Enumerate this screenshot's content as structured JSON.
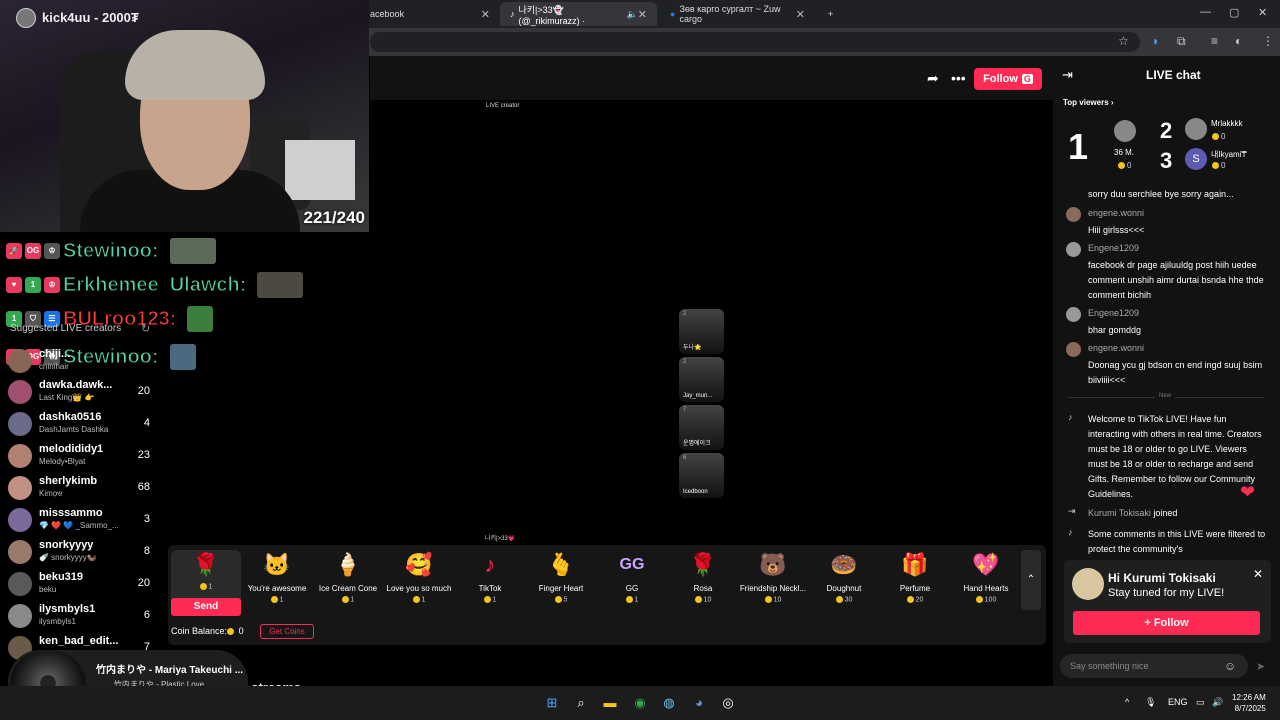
{
  "browser": {
    "tabs": [
      {
        "label": "acebook",
        "active": false
      },
      {
        "label": "나키|>33👻 (@_rikimurazz) ·",
        "active": true
      },
      {
        "label": "Зөв карго сургалт ~ Zuw cargo",
        "active": false
      }
    ],
    "new_tab": "+"
  },
  "webcam": {
    "channel": "kick4uu - 2000₮",
    "count": "221/240"
  },
  "overlay_chat": [
    {
      "name": "Stewinoo:",
      "color": "#4fd8b0",
      "badge": "OG"
    },
    {
      "name": "Erkhemee_Ulawch:",
      "color": "#4fd8b0",
      "badge": "1"
    },
    {
      "name": "BULroo123:",
      "color": "#ff3b3b",
      "badge": "1"
    },
    {
      "name": "Stewinoo:",
      "color": "#4fd8b0",
      "badge": "OG"
    }
  ],
  "sidebar": {
    "suggested_title": "Suggested LIVE creators",
    "creators": [
      {
        "name": "chiji...",
        "sub": "chinihair",
        "count": ""
      },
      {
        "name": "dawka.dawk...",
        "sub": "Last King👑 👉",
        "count": "20"
      },
      {
        "name": "dashka0516",
        "sub": "DashJamts Dashka",
        "count": "4"
      },
      {
        "name": "melodididy1",
        "sub": "Melody•Blyat",
        "count": "23"
      },
      {
        "name": "sherlykimb",
        "sub": "Kimợe",
        "count": "68"
      },
      {
        "name": "misssammo",
        "sub": "💎 ❤️ 💙 _Sammo_...",
        "count": "3"
      },
      {
        "name": "snorkyyyy",
        "sub": "🍼 snorkyyyy🦦",
        "count": "8"
      },
      {
        "name": "beku319",
        "sub": "beku",
        "count": "20"
      },
      {
        "name": "ilysmbyls1",
        "sub": "ilysmbyls1",
        "count": "6"
      },
      {
        "name": "ken_bad_edit...",
        "sub": "",
        "count": "7"
      }
    ]
  },
  "music": {
    "title": "竹内まりや - Mariya Takeuchi ...",
    "subtitle": "竹内まりや - Plastic Love (Official Music Video)"
  },
  "bottom_heading": "ed LIVE streams",
  "stream": {
    "follow_label": "Follow",
    "follow_badge": "G",
    "live_tag": "LIVE creator",
    "mini_title": "나키|>33💗",
    "thumbs": [
      {
        "n": "2",
        "label": "두나🌟"
      },
      {
        "n": "2",
        "label": "Jay_mun..."
      },
      {
        "n": "7",
        "label": "운명에이크"
      },
      {
        "n": "6",
        "label": "Icedboon"
      }
    ]
  },
  "gifts": {
    "send_label": "Send",
    "coin_balance_label": "Coin Balance:",
    "coin_balance": "0",
    "get_coins_label": "Get Coins",
    "items": [
      {
        "name": "",
        "price": "1",
        "icon": "🌹"
      },
      {
        "name": "You're awesome",
        "price": "1",
        "icon": "🐱"
      },
      {
        "name": "Ice Cream Cone",
        "price": "1",
        "icon": "🍦"
      },
      {
        "name": "Love you so much",
        "price": "1",
        "icon": "🥰"
      },
      {
        "name": "TikTok",
        "price": "1",
        "icon": "♪"
      },
      {
        "name": "Finger Heart",
        "price": "5",
        "icon": "🫰"
      },
      {
        "name": "GG",
        "price": "1",
        "icon": "GG"
      },
      {
        "name": "Rosa",
        "price": "10",
        "icon": "🌹"
      },
      {
        "name": "Friendship Neckl...",
        "price": "10",
        "icon": "🐻"
      },
      {
        "name": "Doughnut",
        "price": "30",
        "icon": "🍩"
      },
      {
        "name": "Perfume",
        "price": "20",
        "icon": "🎁"
      },
      {
        "name": "Hand Hearts",
        "price": "100",
        "icon": "💖"
      }
    ]
  },
  "chat": {
    "title": "LIVE chat",
    "top_viewers_label": "Top viewers",
    "top": [
      {
        "rank": "1",
        "name": "36 M.",
        "coins": "0"
      },
      {
        "rank": "2",
        "name": "Mrlakkkk",
        "coins": "0"
      },
      {
        "rank": "3",
        "name": "내Ikyami₸",
        "coins": "0"
      }
    ],
    "messages": [
      {
        "user": "",
        "text": "sorry duu serchlee bye sorry again..."
      },
      {
        "user": "engene.wonni",
        "text": "Hiii girlsss<<<"
      },
      {
        "user": "Engene1209",
        "text": "facebook dr page ajiluuldg post hiih uedee comment unshih aimr durtai bsnda hhe thde comment bichih"
      },
      {
        "user": "Engene1209",
        "text": "bhar gomddg"
      },
      {
        "user": "engene.wonni",
        "text": "Doonag ycu gj bdson cn end ingd suuj bsim biiviiii<<<"
      }
    ],
    "new_label": "New",
    "system_welcome": "Welcome to TikTok LIVE! Have fun interacting with others in real time. Creators must be 18 or older to go LIVE. Viewers must be 18 or older to recharge and send Gifts. Remember to follow our Community Guidelines.",
    "joined_user": "Kurumi Tokisaki",
    "joined_word": "joined",
    "filtered_text": "Some comments in this LIVE were filtered to protect the community's",
    "input_placeholder": "Say something nice"
  },
  "popup": {
    "greeting": "Hi Kurumi Tokisaki",
    "message": "Stay tuned for my LIVE!",
    "follow_label": "+ Follow"
  },
  "taskbar": {
    "lang": "ENG",
    "time": "12:26 AM",
    "date": "8/7/2025"
  },
  "colors": {
    "accent": "#fe2c55",
    "coin": "#f5c518"
  }
}
